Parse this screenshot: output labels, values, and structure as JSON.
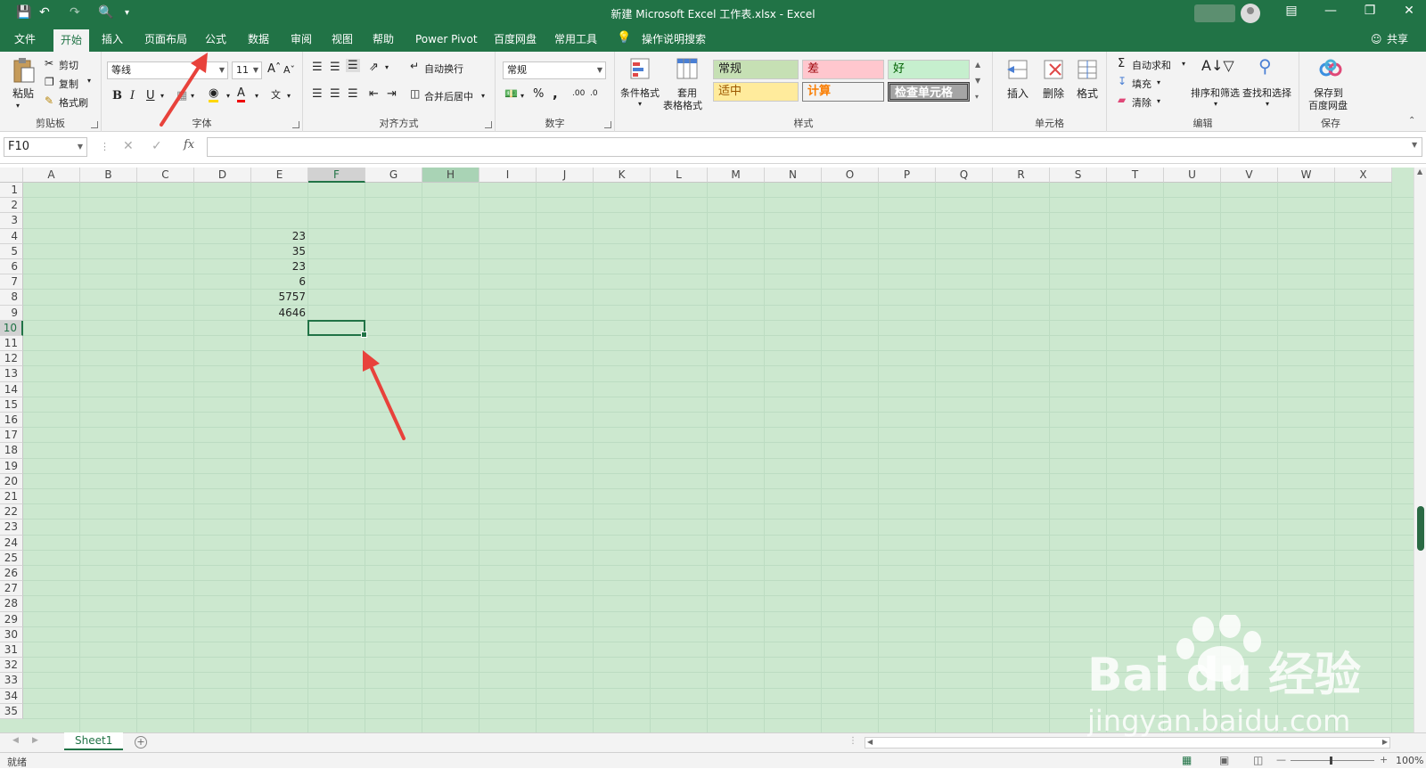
{
  "window": {
    "title": "新建 Microsoft Excel 工作表.xlsx  -  Excel"
  },
  "menu": {
    "tabs": [
      "文件",
      "开始",
      "插入",
      "页面布局",
      "公式",
      "数据",
      "审阅",
      "视图",
      "帮助",
      "Power Pivot",
      "百度网盘",
      "常用工具"
    ],
    "active_tab": "开始",
    "tell_me": "操作说明搜索",
    "share": "共享"
  },
  "ribbon": {
    "clipboard": {
      "paste": "粘贴",
      "cut": "剪切",
      "copy": "复制",
      "format_painter": "格式刷",
      "label": "剪贴板"
    },
    "font": {
      "name": "等线",
      "size": "11",
      "label": "字体"
    },
    "alignment": {
      "wrap": "自动换行",
      "merge": "合并后居中",
      "label": "对齐方式"
    },
    "number": {
      "format": "常规",
      "label": "数字"
    },
    "styles": {
      "conditional": "条件格式",
      "table_format_1": "套用",
      "table_format_2": "表格格式",
      "cells": [
        "常规",
        "差",
        "好",
        "适中",
        "计算",
        "检查单元格"
      ],
      "label": "样式"
    },
    "cells": {
      "insert": "插入",
      "delete": "删除",
      "format": "格式",
      "label": "单元格"
    },
    "editing": {
      "autosum": "自动求和",
      "fill": "填充",
      "clear": "清除",
      "sort": "排序和筛选",
      "find": "查找和选择",
      "label": "编辑"
    },
    "save": {
      "label1": "保存到",
      "label2": "百度网盘",
      "group": "保存"
    }
  },
  "formula_bar": {
    "name_box": "F10",
    "fx": "fx",
    "value": ""
  },
  "grid": {
    "columns": [
      "A",
      "B",
      "C",
      "D",
      "E",
      "F",
      "G",
      "H",
      "I",
      "J",
      "K",
      "L",
      "M",
      "N",
      "O",
      "P",
      "Q",
      "R",
      "S",
      "T",
      "U",
      "V",
      "W",
      "X"
    ],
    "rows": [
      "1",
      "2",
      "3",
      "4",
      "5",
      "6",
      "7",
      "8",
      "9",
      "10",
      "11",
      "12",
      "13",
      "14",
      "15",
      "16",
      "17",
      "18",
      "19",
      "20",
      "21",
      "22",
      "23",
      "24",
      "25",
      "26",
      "27",
      "28",
      "29",
      "30",
      "31",
      "32",
      "33",
      "34",
      "35"
    ],
    "selected_column": "F",
    "highlighted_column": "H",
    "selected_row": "10",
    "cells": [
      {
        "ref": "E4",
        "value": "23"
      },
      {
        "ref": "E5",
        "value": "35"
      },
      {
        "ref": "E6",
        "value": "23"
      },
      {
        "ref": "E7",
        "value": "6"
      },
      {
        "ref": "E8",
        "value": "5757"
      },
      {
        "ref": "E9",
        "value": "4646"
      }
    ]
  },
  "sheets": {
    "tabs": [
      "Sheet1"
    ],
    "active": "Sheet1"
  },
  "status": {
    "ready": "就绪",
    "zoom": "100%"
  },
  "watermark": {
    "brand": "Bai du 经验",
    "url": "jingyan.baidu.com"
  },
  "colors": {
    "excel_green": "#217346",
    "grid_bg": "#cce8cf",
    "arrow": "#e8423b"
  }
}
